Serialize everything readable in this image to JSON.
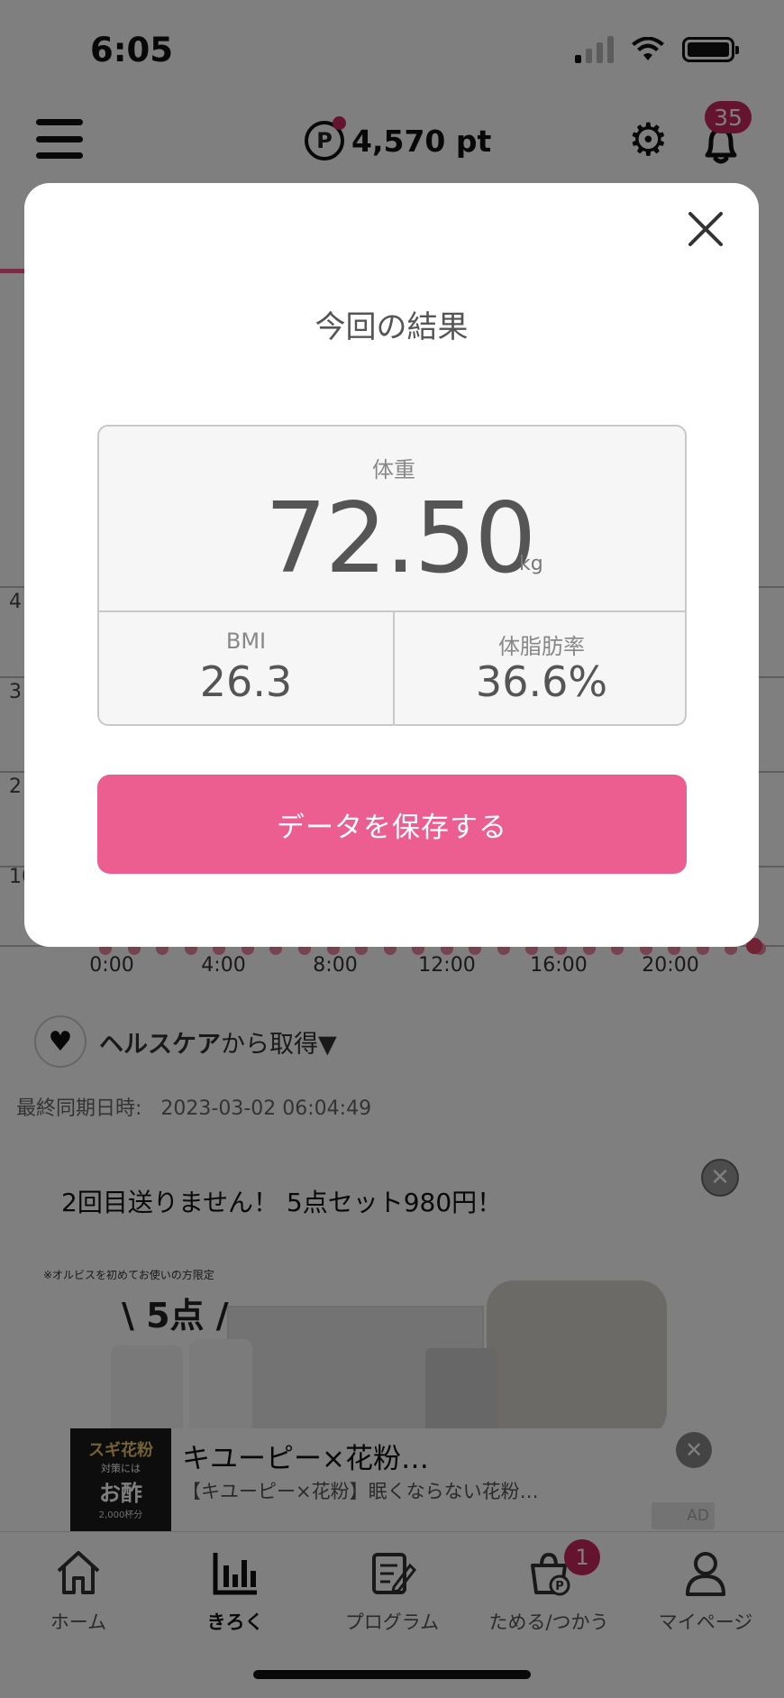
{
  "status_bar": {
    "time": "6:05"
  },
  "header": {
    "points": "4,570 pt",
    "points_icon": "P",
    "notification_count": "35"
  },
  "chart": {
    "y_ticks": [
      "4",
      "3",
      "2",
      "10"
    ],
    "x_ticks": [
      "0:00",
      "4:00",
      "8:00",
      "12:00",
      "16:00",
      "20:00"
    ]
  },
  "health": {
    "source_bold": "ヘルスケア",
    "source_rest": "から取得▼"
  },
  "sync": {
    "label": "最終同期日時:",
    "datetime": "2023-03-02 06:04:49"
  },
  "ad": {
    "title": "2回目送りません！ 5点セット980円！",
    "note": "※オルビスを初めてお使いの方限定",
    "count_text": "\\ 5点 /",
    "close": "✕"
  },
  "banner": {
    "thumb_line1": "スギ花粉",
    "thumb_line2": "対策には",
    "thumb_line3": "お酢",
    "thumb_line4": "2,000杯分",
    "title": "キユーピー×花粉…",
    "description": "【キユーピー×花粉】眠くならない花粉…",
    "ad_label": "AD",
    "close": "✕"
  },
  "tabs": [
    {
      "label": "ホーム",
      "icon": "home-icon"
    },
    {
      "label": "きろく",
      "icon": "chart-icon",
      "active": true
    },
    {
      "label": "プログラム",
      "icon": "program-icon"
    },
    {
      "label": "ためる/つかう",
      "icon": "points-bag-icon",
      "badge": "1"
    },
    {
      "label": "マイページ",
      "icon": "person-icon"
    }
  ],
  "modal": {
    "title": "今回の結果",
    "weight_label": "体重",
    "weight_value": "72.50",
    "weight_unit": "kg",
    "bmi_label": "BMI",
    "bmi_value": "26.3",
    "bodyfat_label": "体脂肪率",
    "bodyfat_value": "36.6%",
    "save_label": "データを保存する"
  },
  "colors": {
    "accent": "#ed5e90",
    "badge": "#c8285f"
  }
}
